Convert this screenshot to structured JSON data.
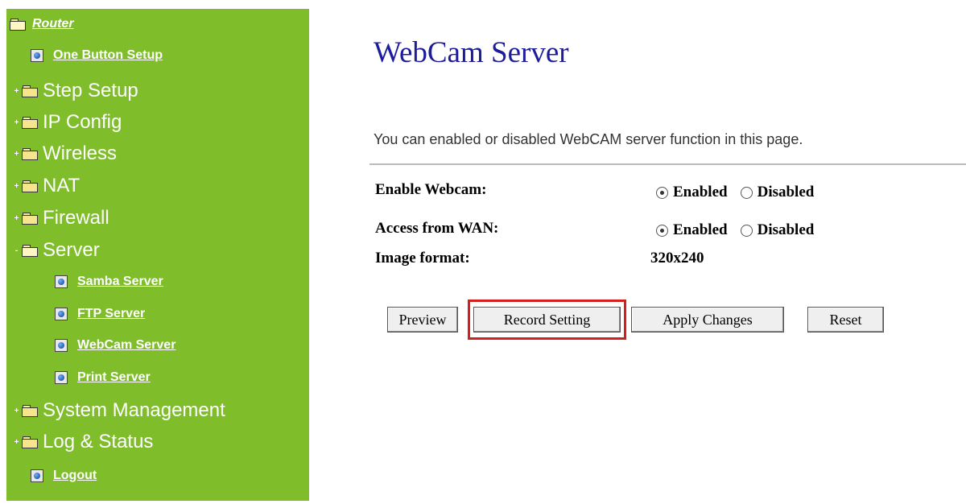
{
  "sidebar": {
    "root": "Router",
    "items": [
      {
        "label": "One Button Setup",
        "kind": "page"
      },
      {
        "label": "Step Setup",
        "kind": "folder",
        "expander": "+"
      },
      {
        "label": "IP Config",
        "kind": "folder",
        "expander": "+"
      },
      {
        "label": "Wireless",
        "kind": "folder",
        "expander": "+"
      },
      {
        "label": "NAT",
        "kind": "folder",
        "expander": "+"
      },
      {
        "label": "Firewall",
        "kind": "folder",
        "expander": "+"
      },
      {
        "label": "Server",
        "kind": "folder",
        "expander": "-"
      },
      {
        "label": "Samba Server",
        "kind": "page"
      },
      {
        "label": "FTP Server",
        "kind": "page"
      },
      {
        "label": "WebCam Server",
        "kind": "page"
      },
      {
        "label": "Print Server",
        "kind": "page"
      },
      {
        "label": "System Management",
        "kind": "folder",
        "expander": "+"
      },
      {
        "label": "Log & Status",
        "kind": "folder",
        "expander": "+"
      },
      {
        "label": "Logout",
        "kind": "page"
      }
    ]
  },
  "main": {
    "title": "WebCam Server",
    "description": "You can enabled or disabled WebCAM server function in this page.",
    "fields": {
      "enable_webcam": {
        "label": "Enable Webcam:",
        "options": [
          "Enabled",
          "Disabled"
        ],
        "selected": "Enabled"
      },
      "access_wan": {
        "label": "Access from WAN:",
        "options": [
          "Enabled",
          "Disabled"
        ],
        "selected": "Enabled"
      },
      "image_format": {
        "label": "Image format:",
        "value": "320x240"
      }
    },
    "buttons": {
      "preview": "Preview",
      "record_setting": "Record Setting",
      "apply": "Apply Changes",
      "reset": "Reset"
    }
  },
  "colors": {
    "sidebar_bg": "#7fbe2a",
    "title": "#1d1d9c",
    "highlight": "#d41f1f"
  }
}
